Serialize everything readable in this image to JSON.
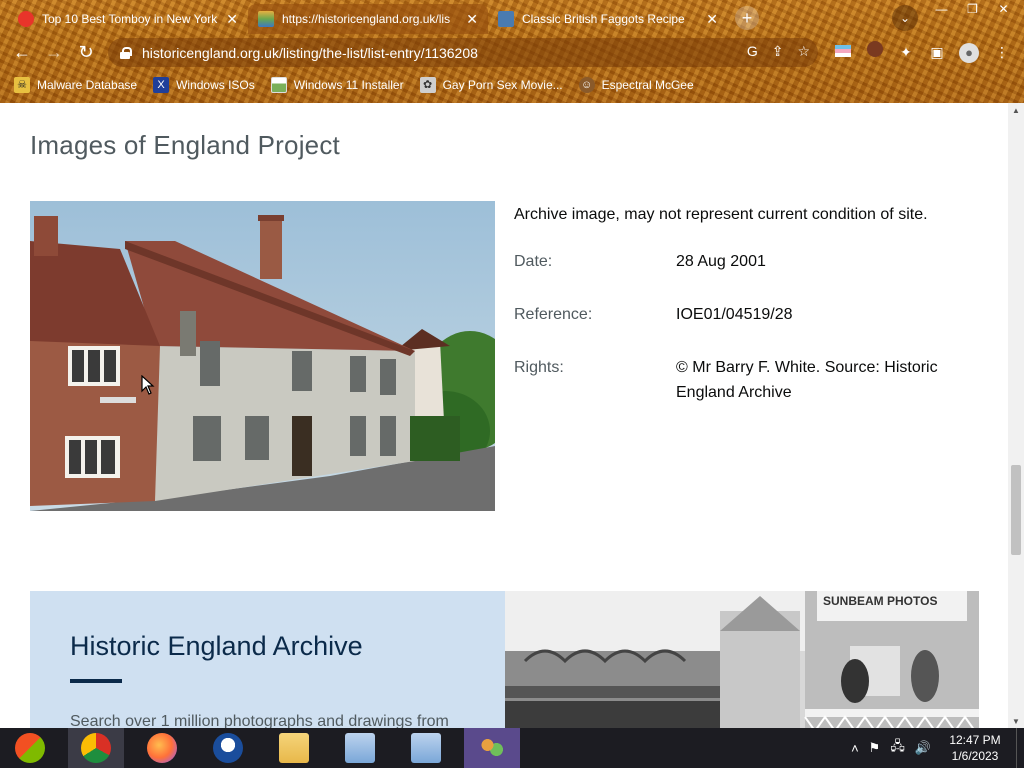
{
  "browser": {
    "tabs": [
      {
        "title": "Top 10 Best Tomboy in New York",
        "favicon_color": "#e8342a"
      },
      {
        "title": "https://historicengland.org.uk/lis",
        "favicon_color": "#6aa84f"
      },
      {
        "title": "Classic British Faggots Recipe",
        "favicon_color": "#4a7bb0"
      }
    ],
    "close_glyph": "✕",
    "new_tab_glyph": "+",
    "tab_menu_glyph": "⌄",
    "window_controls": [
      "—",
      "❐",
      "✕"
    ],
    "url": "historicengland.org.uk/listing/the-list/list-entry/1136208",
    "bookmarks": [
      {
        "label": "Malware Database",
        "icon": "skull-icon",
        "color": "#e8c040"
      },
      {
        "label": "Windows ISOs",
        "icon": "x-box-icon",
        "color": "#1f3f9a"
      },
      {
        "label": "Windows 11 Installer",
        "icon": "image-icon",
        "color": "#7ab05a"
      },
      {
        "label": "Gay Porn Sex Movie...",
        "icon": "flower-icon",
        "color": "#cfcfcf"
      },
      {
        "label": "Espectral McGee",
        "icon": "face-icon",
        "color": "#8a5a2a"
      }
    ]
  },
  "page": {
    "section_title": "Images of England Project",
    "caption": "Archive image, may not represent current condition of site.",
    "details": [
      {
        "label": "Date:",
        "value": "28 Aug 2001"
      },
      {
        "label": "Reference:",
        "value": "IOE01/04519/28"
      },
      {
        "label": "Rights:",
        "value": "© Mr Barry F. White. Source: Historic England Archive"
      }
    ],
    "archive": {
      "title": "Historic England Archive",
      "description": "Search over 1 million photographs and drawings from",
      "pier_sign": "SUNBEAM PHOTOS"
    }
  },
  "taskbar": {
    "apps": [
      {
        "name": "start-button",
        "color": "#2e7bd4"
      },
      {
        "name": "chrome-app",
        "color": "#d93025"
      },
      {
        "name": "firefox-app",
        "color": "#ff7139"
      },
      {
        "name": "obama-app",
        "color": "#1a4d9c"
      },
      {
        "name": "file-explorer-app",
        "color": "#e8b84a"
      },
      {
        "name": "network-setup-app",
        "color": "#7aa7d8"
      },
      {
        "name": "network-setup-app-2",
        "color": "#7aa7d8"
      },
      {
        "name": "teams-app",
        "color": "#6264a7"
      }
    ],
    "time": "12:47 PM",
    "date": "1/6/2023"
  }
}
